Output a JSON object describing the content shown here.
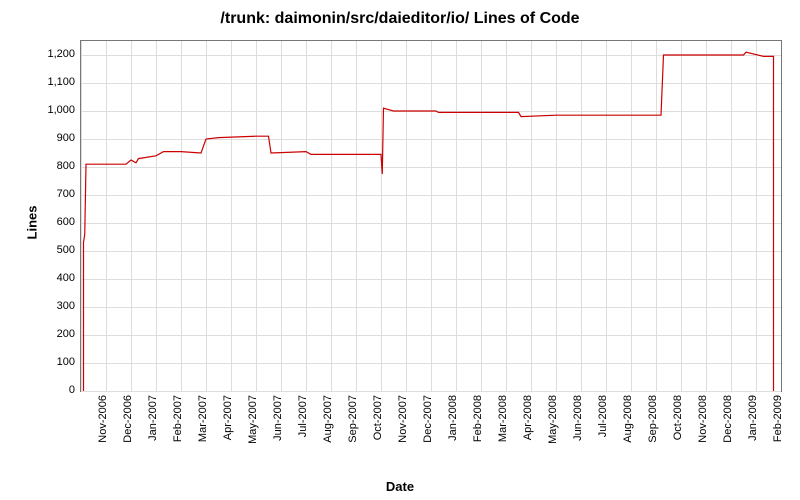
{
  "chart_data": {
    "type": "line",
    "title": "/trunk: daimonin/src/daieditor/io/ Lines of Code",
    "xlabel": "Date",
    "ylabel": "Lines",
    "ylim": [
      0,
      1250
    ],
    "y_ticks": [
      0,
      100,
      200,
      300,
      400,
      500,
      600,
      700,
      800,
      900,
      1000,
      1100,
      1200
    ],
    "x_categories": [
      "Nov-2006",
      "Dec-2006",
      "Jan-2007",
      "Feb-2007",
      "Mar-2007",
      "Apr-2007",
      "May-2007",
      "Jun-2007",
      "Jul-2007",
      "Aug-2007",
      "Sep-2007",
      "Oct-2007",
      "Nov-2007",
      "Dec-2007",
      "Jan-2008",
      "Feb-2008",
      "Mar-2008",
      "Apr-2008",
      "May-2008",
      "Jun-2008",
      "Jul-2008",
      "Aug-2008",
      "Sep-2008",
      "Oct-2008",
      "Nov-2008",
      "Dec-2008",
      "Jan-2009",
      "Feb-2009"
    ],
    "series": [
      {
        "name": "Lines of Code",
        "color": "#cc0000",
        "points": [
          {
            "x": 0.1,
            "y": 0
          },
          {
            "x": 0.1,
            "y": 530
          },
          {
            "x": 0.15,
            "y": 560
          },
          {
            "x": 0.2,
            "y": 810
          },
          {
            "x": 1.8,
            "y": 810
          },
          {
            "x": 2.0,
            "y": 825
          },
          {
            "x": 2.2,
            "y": 815
          },
          {
            "x": 2.3,
            "y": 830
          },
          {
            "x": 3.0,
            "y": 840
          },
          {
            "x": 3.3,
            "y": 855
          },
          {
            "x": 4.0,
            "y": 855
          },
          {
            "x": 4.8,
            "y": 850
          },
          {
            "x": 5.0,
            "y": 900
          },
          {
            "x": 5.5,
            "y": 905
          },
          {
            "x": 7.0,
            "y": 910
          },
          {
            "x": 7.5,
            "y": 910
          },
          {
            "x": 7.6,
            "y": 850
          },
          {
            "x": 9.0,
            "y": 855
          },
          {
            "x": 9.2,
            "y": 845
          },
          {
            "x": 12.0,
            "y": 845
          },
          {
            "x": 12.05,
            "y": 775
          },
          {
            "x": 12.1,
            "y": 1010
          },
          {
            "x": 12.5,
            "y": 1000
          },
          {
            "x": 14.0,
            "y": 1000
          },
          {
            "x": 14.2,
            "y": 1000
          },
          {
            "x": 14.3,
            "y": 995
          },
          {
            "x": 17.5,
            "y": 995
          },
          {
            "x": 17.6,
            "y": 980
          },
          {
            "x": 19.0,
            "y": 985
          },
          {
            "x": 22.0,
            "y": 985
          },
          {
            "x": 22.2,
            "y": 985
          },
          {
            "x": 23.2,
            "y": 985
          },
          {
            "x": 23.3,
            "y": 1200
          },
          {
            "x": 26.5,
            "y": 1200
          },
          {
            "x": 26.6,
            "y": 1210
          },
          {
            "x": 27.3,
            "y": 1195
          },
          {
            "x": 27.7,
            "y": 1195
          },
          {
            "x": 27.7,
            "y": 0
          }
        ]
      }
    ]
  }
}
